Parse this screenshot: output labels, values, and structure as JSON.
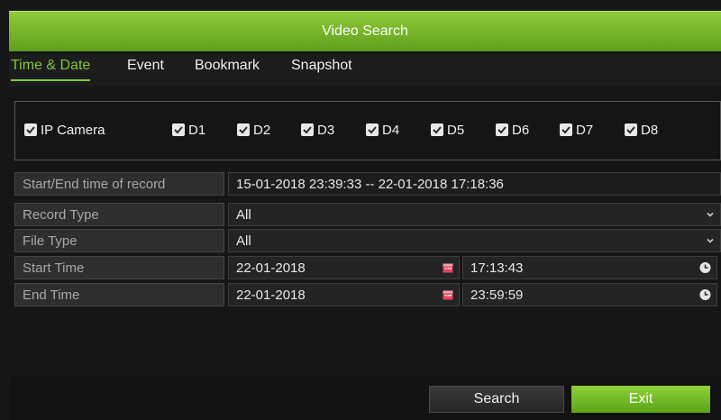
{
  "window": {
    "title": "Video Search"
  },
  "tabs": [
    {
      "label": "Time & Date",
      "active": true
    },
    {
      "label": "Event",
      "active": false
    },
    {
      "label": "Bookmark",
      "active": false
    },
    {
      "label": "Snapshot",
      "active": false
    }
  ],
  "cameras": {
    "all_label": "IP Camera",
    "all_checked": true,
    "items": [
      {
        "label": "D1",
        "checked": true
      },
      {
        "label": "D2",
        "checked": true
      },
      {
        "label": "D3",
        "checked": true
      },
      {
        "label": "D4",
        "checked": true
      },
      {
        "label": "D5",
        "checked": true
      },
      {
        "label": "D6",
        "checked": true
      },
      {
        "label": "D7",
        "checked": true
      },
      {
        "label": "D8",
        "checked": true
      }
    ]
  },
  "form": {
    "record_range": {
      "label": "Start/End time of record",
      "value": "15-01-2018 23:39:33 -- 22-01-2018 17:18:36"
    },
    "record_type": {
      "label": "Record Type",
      "value": "All"
    },
    "file_type": {
      "label": "File Type",
      "value": "All"
    },
    "start_time": {
      "label": "Start Time",
      "date": "22-01-2018",
      "time": "17:13:43"
    },
    "end_time": {
      "label": "End Time",
      "date": "22-01-2018",
      "time": "23:59:59"
    }
  },
  "buttons": {
    "search": "Search",
    "exit": "Exit"
  },
  "colors": {
    "accent": "#82c83a",
    "title_bar": "#6fb02a",
    "calendar_icon": "#e8435a"
  }
}
